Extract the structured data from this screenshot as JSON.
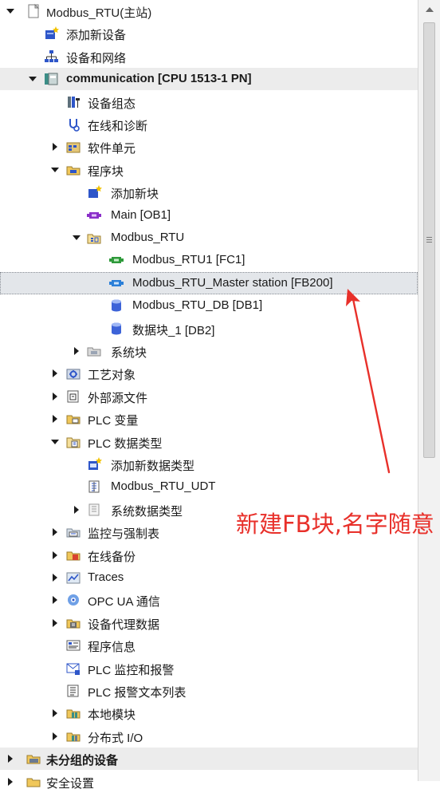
{
  "tree": [
    {
      "label": "Modbus_RTU(主站)",
      "icon": "page",
      "toggle": "expanded",
      "style": "top"
    },
    {
      "label": "添加新设备",
      "icon": "add-device",
      "toggle": "none"
    },
    {
      "label": "设备和网络",
      "icon": "network",
      "toggle": "none"
    },
    {
      "label": "communication [CPU 1513-1 PN]",
      "icon": "cpu",
      "toggle": "expanded",
      "style": "bold-band"
    },
    {
      "label": "设备组态",
      "icon": "device-config",
      "toggle": "none"
    },
    {
      "label": "在线和诊断",
      "icon": "diagnostics",
      "toggle": "none"
    },
    {
      "label": "软件单元",
      "icon": "software-units",
      "toggle": "collapsed"
    },
    {
      "label": "程序块",
      "icon": "folder-blocks",
      "toggle": "expanded"
    },
    {
      "label": "添加新块",
      "icon": "add-block",
      "toggle": "none"
    },
    {
      "label": "Main [OB1]",
      "icon": "ob-block",
      "toggle": "none"
    },
    {
      "label": "Modbus_RTU",
      "icon": "group-folder",
      "toggle": "expanded"
    },
    {
      "label": "Modbus_RTU1 [FC1]",
      "icon": "fc-block",
      "toggle": "none"
    },
    {
      "label": "Modbus_RTU_Master station [FB200]",
      "icon": "fb-block",
      "toggle": "none",
      "style": "selected"
    },
    {
      "label": "Modbus_RTU_DB [DB1]",
      "icon": "db-block",
      "toggle": "none"
    },
    {
      "label": "数据块_1 [DB2]",
      "icon": "db-block",
      "toggle": "none"
    },
    {
      "label": "系统块",
      "icon": "system-blocks",
      "toggle": "collapsed"
    },
    {
      "label": "工艺对象",
      "icon": "technology-objects",
      "toggle": "collapsed"
    },
    {
      "label": "外部源文件",
      "icon": "external-source",
      "toggle": "collapsed"
    },
    {
      "label": "PLC 变量",
      "icon": "plc-tags",
      "toggle": "collapsed"
    },
    {
      "label": "PLC 数据类型",
      "icon": "data-types",
      "toggle": "expanded"
    },
    {
      "label": "添加新数据类型",
      "icon": "add-datatype",
      "toggle": "none"
    },
    {
      "label": "Modbus_RTU_UDT",
      "icon": "udt",
      "toggle": "none"
    },
    {
      "label": "系统数据类型",
      "icon": "system-datatypes",
      "toggle": "collapsed"
    },
    {
      "label": "监控与强制表",
      "icon": "watch-tables",
      "toggle": "collapsed"
    },
    {
      "label": "在线备份",
      "icon": "online-backup",
      "toggle": "collapsed"
    },
    {
      "label": "Traces",
      "icon": "traces",
      "toggle": "collapsed"
    },
    {
      "label": "OPC UA 通信",
      "icon": "opc-ua",
      "toggle": "collapsed"
    },
    {
      "label": "设备代理数据",
      "icon": "device-proxy",
      "toggle": "collapsed"
    },
    {
      "label": "程序信息",
      "icon": "program-info",
      "toggle": "none"
    },
    {
      "label": "PLC 监控和报警",
      "icon": "plc-alarms",
      "toggle": "none"
    },
    {
      "label": "PLC 报警文本列表",
      "icon": "alarm-text",
      "toggle": "none"
    },
    {
      "label": "本地模块",
      "icon": "local-modules",
      "toggle": "collapsed"
    },
    {
      "label": "分布式 I/O",
      "icon": "distributed-io",
      "toggle": "collapsed"
    },
    {
      "label": "未分组的设备",
      "icon": "ungrouped-devices",
      "toggle": "collapsed",
      "style": "bold-band"
    },
    {
      "label": "安全设置",
      "icon": "security",
      "toggle": "collapsed"
    }
  ],
  "annotation": {
    "text": "新建FB块,名字随意",
    "color": "#e8302a"
  },
  "scrollbar": {
    "up_icon": "arrow-up-icon",
    "grip_icon": "grip-icon"
  }
}
